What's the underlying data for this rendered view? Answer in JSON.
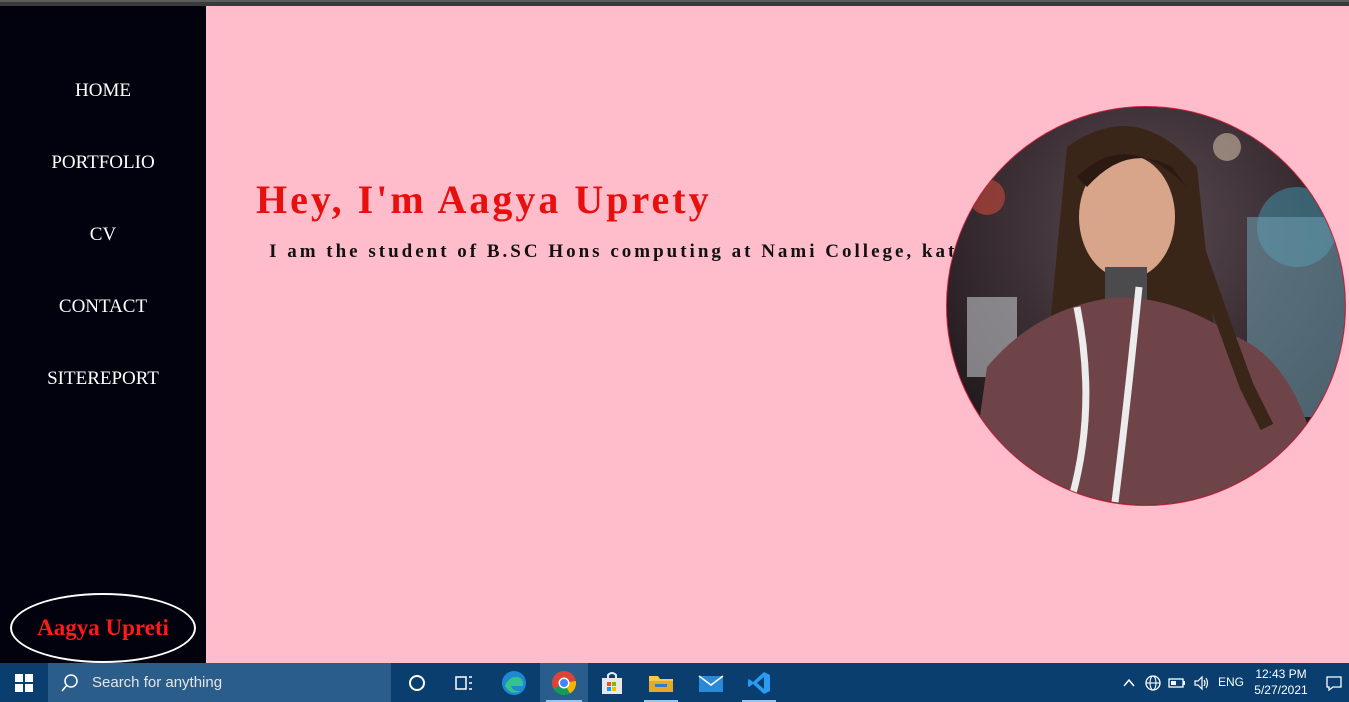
{
  "sidebar": {
    "nav": [
      "HOME",
      "PORTFOLIO",
      "CV",
      "CONTACT",
      "SITEREPORT"
    ],
    "logo_text": "Aagya Upreti"
  },
  "hero": {
    "title": "Hey, I'm Aagya Uprety",
    "subtitle": "I am the student of B.SC Hons computing at Nami College, kathmandu"
  },
  "taskbar": {
    "search_placeholder": "Search for anything",
    "language": "ENG",
    "time": "12:43 PM",
    "date": "5/27/2021",
    "apps": [
      "cortana-icon",
      "task-view-icon",
      "edge-icon",
      "chrome-icon",
      "store-icon",
      "file-explorer-icon",
      "mail-icon",
      "vscode-icon"
    ],
    "tray": [
      "chevron-up-icon",
      "network-globe-icon",
      "battery-icon",
      "volume-icon",
      "notification-icon"
    ]
  },
  "colors": {
    "sidebar_bg": "#02020f",
    "main_bg": "#ffbccb",
    "title_red": "#e80f0f",
    "taskbar_bg": "#0a3e6e"
  }
}
